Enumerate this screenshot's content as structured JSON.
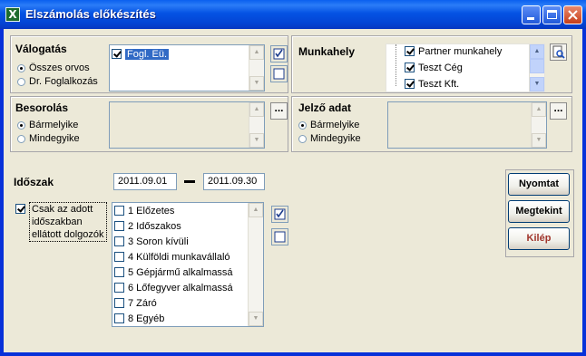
{
  "window": {
    "title": "Elszámolás előkészítés",
    "icon": "x-app-icon"
  },
  "valogatas": {
    "title": "Válogatás",
    "radios": [
      {
        "label": "Összes orvos",
        "selected": true
      },
      {
        "label": "Dr. Foglalkozás",
        "selected": false
      }
    ],
    "list": [
      {
        "label": "Fogl. Eü.",
        "checked": true,
        "selected": true
      }
    ]
  },
  "munkahely": {
    "title": "Munkahely",
    "list": [
      {
        "label": "Partner munkahely",
        "checked": true
      },
      {
        "label": "Teszt Cég",
        "checked": true
      },
      {
        "label": "Teszt Kft.",
        "checked": true
      }
    ]
  },
  "besorolas": {
    "title": "Besorolás",
    "radios": [
      {
        "label": "Bármelyike",
        "selected": true
      },
      {
        "label": "Mindegyike",
        "selected": false
      }
    ],
    "more": "..."
  },
  "jelzo": {
    "title": "Jelző adat",
    "radios": [
      {
        "label": "Bármelyike",
        "selected": true
      },
      {
        "label": "Mindegyike",
        "selected": false
      }
    ],
    "more": "..."
  },
  "idoszak": {
    "label": "Időszak",
    "from": "2011.09.01",
    "to": "2011.09.30"
  },
  "only_period": {
    "checked": true,
    "lines": [
      "Csak az adott",
      "időszakban",
      "ellátott dolgozók"
    ]
  },
  "categories": [
    {
      "label": "1 Előzetes",
      "checked": false
    },
    {
      "label": "2 Időszakos",
      "checked": false
    },
    {
      "label": "3 Soron kívüli",
      "checked": false
    },
    {
      "label": "4 Külföldi munkavállaló",
      "checked": false
    },
    {
      "label": "5 Gépjármű alkalmassá",
      "checked": false
    },
    {
      "label": "6 Lőfegyver alkalmassá",
      "checked": false
    },
    {
      "label": "7 Záró",
      "checked": false
    },
    {
      "label": "8 Egyéb",
      "checked": false
    }
  ],
  "buttons": {
    "print": "Nyomtat",
    "view": "Megtekint",
    "exit": "Kilép"
  },
  "colors": {
    "titlebar": "#0553E4",
    "selection": "#316AC5",
    "exit_text": "#A0352C",
    "face": "#ECE9D8"
  }
}
